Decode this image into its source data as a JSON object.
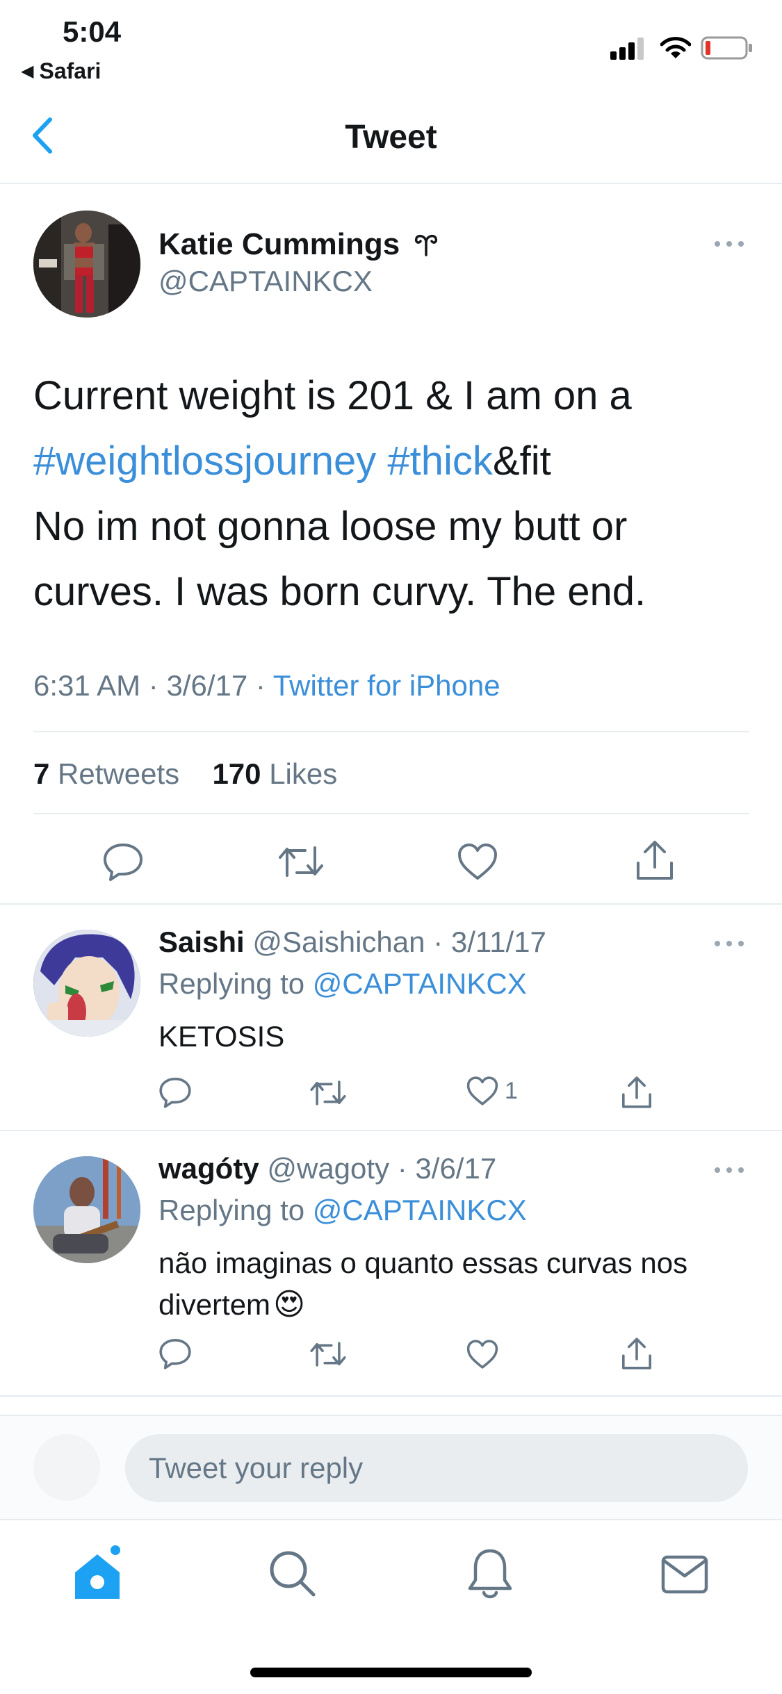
{
  "status_bar": {
    "time": "5:04",
    "back_app": "Safari"
  },
  "nav": {
    "title": "Tweet"
  },
  "tweet": {
    "author_name": "Katie Cummings",
    "author_handle": "@CAPTAINKCX",
    "text_line1": "Current weight is 201 & I am on a",
    "hashtag1": "#weightlossjourney",
    "hashtag2": "#thick",
    "text_after_hashtag": "&fit",
    "text_line3": "No im not gonna loose my butt or",
    "text_line4": "curves. I was born curvy. The end.",
    "time": "6:31 AM",
    "date": "3/6/17",
    "source": "Twitter for iPhone",
    "retweets_count": "7",
    "retweets_label": "Retweets",
    "likes_count": "170",
    "likes_label": "Likes"
  },
  "replies": [
    {
      "name": "Saishi",
      "handle": "@Saishichan",
      "date": "3/11/17",
      "replying_label": "Replying to",
      "replying_to": "@CAPTAINKCX",
      "text": "KETOSIS",
      "like_count": "1"
    },
    {
      "name": "wagóty",
      "handle": "@wagoty",
      "date": "3/6/17",
      "replying_label": "Replying to",
      "replying_to": "@CAPTAINKCX",
      "text_line1": "não imaginas o quanto essas curvas nos",
      "text_line2": "divertem",
      "emoji": "😍"
    }
  ],
  "reply_box": {
    "placeholder": "Tweet your reply"
  },
  "tab_bar": {
    "items": [
      "home-icon",
      "search-icon",
      "notifications-icon",
      "messages-icon"
    ]
  },
  "colors": {
    "accent": "#1da1f2",
    "muted": "#657786",
    "divider": "#e6ecf0"
  }
}
